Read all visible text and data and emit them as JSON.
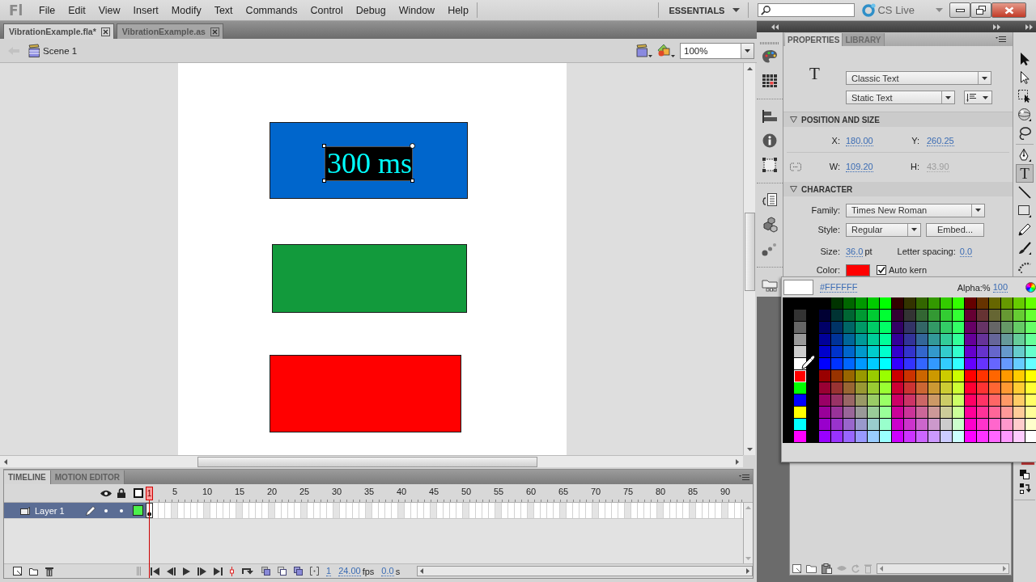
{
  "menu_bar": {
    "logo": "Fl",
    "items": [
      "File",
      "Edit",
      "View",
      "Insert",
      "Modify",
      "Text",
      "Commands",
      "Control",
      "Debug",
      "Window",
      "Help"
    ],
    "workspace": "ESSENTIALS",
    "cs_live": "CS Live"
  },
  "document_tabs": [
    {
      "label": "VibrationExample.fla*",
      "selected": true
    },
    {
      "label": "VibrationExample.as",
      "selected": false
    }
  ],
  "edit_bar": {
    "scene": "Scene 1",
    "zoom": "100%"
  },
  "stage": {
    "shapes": [
      {
        "kind": "rectangle",
        "color": "#0066cc"
      },
      {
        "kind": "rectangle",
        "color": "#129a3c"
      },
      {
        "kind": "rectangle",
        "color": "#ff0000"
      }
    ],
    "text_field": {
      "text": "300 ms",
      "selected": true
    }
  },
  "timeline": {
    "tabs": [
      {
        "label": "TIMELINE",
        "selected": true
      },
      {
        "label": "MOTION EDITOR",
        "selected": false
      }
    ],
    "playhead": "1",
    "ruler": [
      "5",
      "10",
      "15",
      "20",
      "25",
      "30",
      "35",
      "40",
      "45",
      "50",
      "55",
      "60",
      "65",
      "70",
      "75",
      "80",
      "85",
      "90"
    ],
    "layers": [
      {
        "name": "Layer 1",
        "selected": true,
        "hidden": false,
        "locked": false,
        "color": "#4cf04c",
        "keyframe_filled": true
      }
    ],
    "current_frame": "1",
    "frame_rate": "24.00",
    "frame_rate_unit": "fps",
    "elapsed": "0.0",
    "elapsed_unit": "s"
  },
  "properties_panel": {
    "tabs": [
      {
        "label": "PROPERTIES",
        "selected": true
      },
      {
        "label": "LIBRARY",
        "selected": false
      }
    ],
    "type_glyph": "T",
    "text_engine": "Classic Text",
    "text_type": "Static Text",
    "position_size": {
      "title": "POSITION AND SIZE",
      "expanded": true,
      "fields": [
        {
          "label": "X:",
          "value": "180.00",
          "disabled": false
        },
        {
          "label": "Y:",
          "value": "260.25",
          "disabled": false
        },
        {
          "label": "W:",
          "value": "109.20",
          "disabled": false
        },
        {
          "label": "H:",
          "value": "43.90",
          "disabled": true
        }
      ]
    },
    "character": {
      "title": "CHARACTER",
      "expanded": true,
      "family_label": "Family:",
      "family": "Times New Roman",
      "style_label": "Style:",
      "style": "Regular",
      "embed_button": "Embed...",
      "size_label": "Size:",
      "size": "36.0",
      "size_unit": "pt",
      "letter_spacing_label": "Letter spacing:",
      "letter_spacing": "0.0",
      "color_label": "Color:",
      "color": "#ff0000",
      "auto_kern": {
        "label": "Auto kern",
        "checked": true
      }
    }
  },
  "tools_panel": {
    "tools": [
      {
        "kind": "selection",
        "selected": false
      },
      {
        "kind": "subselection",
        "selected": false
      },
      {
        "kind": "transform",
        "selected": false
      },
      {
        "kind": "rotation",
        "selected": false
      },
      {
        "kind": "lasso",
        "selected": false
      },
      {
        "kind": "pen",
        "selected": false
      },
      {
        "kind": "text",
        "glyph": "T",
        "selected": true
      },
      {
        "kind": "line",
        "selected": false
      },
      {
        "kind": "rectangle",
        "selected": false
      },
      {
        "kind": "pencil",
        "selected": false
      },
      {
        "kind": "brush",
        "selected": false
      },
      {
        "kind": "deco",
        "selected": false
      }
    ]
  },
  "color_picker": {
    "hex": "#FFFFFF",
    "alpha_label": "Alpha:%",
    "alpha": "100",
    "swatches": [
      {
        "color": "#333333",
        "selected": false
      },
      {
        "color": "#666666",
        "selected": false
      },
      {
        "color": "#999999",
        "selected": false
      },
      {
        "color": "#cccccc",
        "selected": false
      },
      {
        "color": "#ffffff",
        "selected": false
      },
      {
        "color": "#ff0000",
        "selected": true
      },
      {
        "color": "#00ff00",
        "selected": false
      },
      {
        "color": "#0000ff",
        "selected": false
      },
      {
        "color": "#ffff00",
        "selected": false
      },
      {
        "color": "#00ffff",
        "selected": false
      },
      {
        "color": "#ff00ff",
        "selected": false
      }
    ]
  }
}
